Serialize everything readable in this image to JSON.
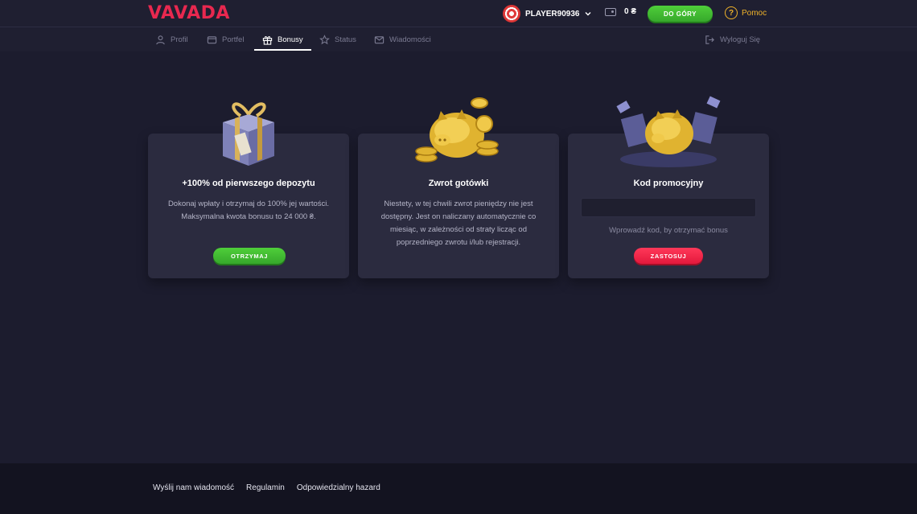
{
  "header": {
    "logo": "VAVADA",
    "username": "PLAYER90936",
    "balance": "0 ₴",
    "deposit_label": "DO GÓRY",
    "help_label": "Pomoc"
  },
  "tabs": [
    {
      "label": "Profil",
      "icon": "user-icon"
    },
    {
      "label": "Portfel",
      "icon": "wallet-icon"
    },
    {
      "label": "Bonusy",
      "icon": "gift-icon",
      "active": true
    },
    {
      "label": "Status",
      "icon": "star-icon"
    },
    {
      "label": "Wiadomości",
      "icon": "mail-icon"
    }
  ],
  "logout_label": "Wyloguj Się",
  "cards": {
    "deposit": {
      "title": "+100% od pierwszego depozytu",
      "text": "Dokonaj wpłaty i otrzymaj do 100% jej wartości. Maksymalna kwota bonusu to 24 000 ₴.",
      "button": "OTRZYMAJ"
    },
    "cashback": {
      "title": "Zwrot gotówki",
      "text": "Niestety, w tej chwili zwrot pieniędzy nie jest dostępny. Jest on naliczany automatycznie co miesiąc, w zależności od straty licząc od poprzedniego zwrotu i/lub rejestracji."
    },
    "promo": {
      "title": "Kod promocyjny",
      "input_value": "",
      "hint": "Wprowadź kod, by otrzymać bonus",
      "button": "ZASTOSUJ"
    }
  },
  "footer": {
    "links": [
      "Wyślij nam wiadomość",
      "Regulamin",
      "Odpowiedzialny hazard"
    ]
  },
  "colors": {
    "brand": "#e8284f",
    "accent_green": "#4fcf3a",
    "accent_red": "#ff3859",
    "help": "#f0b32a",
    "background": "#1c1c2e",
    "card": "#2b2b3f"
  }
}
